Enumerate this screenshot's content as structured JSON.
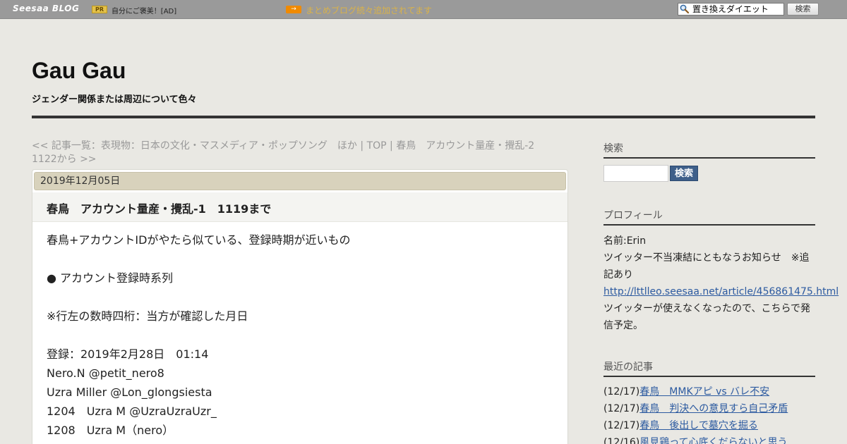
{
  "topbar": {
    "logo": "Seesaa BLOG",
    "pr_badge": "PR",
    "ad_text": "自分にご褒美！[AD]",
    "promo_icon": "→",
    "promo_text": "まとめブログ続々追加されてます",
    "search_value": "置き換えダイエット",
    "search_button": "検索"
  },
  "header": {
    "title": "Gau Gau",
    "description": "ジェンダー関係または周辺について色々"
  },
  "nav": {
    "prev": "<< 記事一覧：表現物：日本の文化・マスメディア・ポップソング　ほか",
    "sep1": " | ",
    "top": "TOP",
    "sep2": " | ",
    "next": "春鳥　アカウント量産・攪乱-2　1122から >>"
  },
  "post": {
    "date": "2019年12月05日",
    "title": "春鳥　アカウント量産・攪乱-1　1119まで",
    "lines": [
      "春鳥+アカウントIDがやたら似ている、登録時期が近いもの",
      "",
      "● アカウント登録時系列",
      "",
      "※行左の数時四桁：当方が確認した月日",
      "",
      "登録：2019年2月28日　01:14",
      "Nero.N @petit_nero8",
      "Uzra Miller @Lon_glongsiesta",
      "1204　Uzra M @UzraUzraUzr_",
      "1208　Uzra M（nero）"
    ]
  },
  "sidebar": {
    "search_head": "検索",
    "search_button": "検索",
    "profile_head": "プロフィール",
    "profile_name": "名前:Erin",
    "profile_text1": "ツイッター不当凍結にともなうお知らせ　※追記あり",
    "profile_link": "http://lttlleo.seesaa.net/article/456861475.html",
    "profile_text2": "ツイッターが使えなくなったので、こちらで発信予定。",
    "recent_head": "最近の記事",
    "recent": [
      {
        "date": "(12/17)",
        "title": "春鳥　MMKアピ vs バレ不安"
      },
      {
        "date": "(12/17)",
        "title": "春鳥　判決への意見すら自己矛盾"
      },
      {
        "date": "(12/17)",
        "title": "春鳥　後出しで墓穴を掘る"
      },
      {
        "date": "(12/16)",
        "title": "風見鶏って心底くだらないと思う"
      }
    ]
  }
}
